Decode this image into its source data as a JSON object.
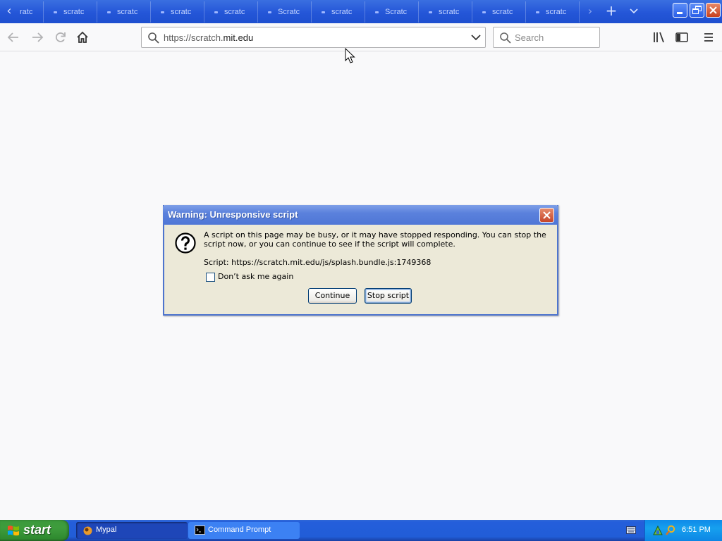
{
  "browser": {
    "tabs": [
      {
        "label": "ratc"
      },
      {
        "label": "scratc"
      },
      {
        "label": "scratc"
      },
      {
        "label": "scratc"
      },
      {
        "label": "scratc"
      },
      {
        "label": "Scratc"
      },
      {
        "label": "scratc"
      },
      {
        "label": "Scratc"
      },
      {
        "label": "scratc"
      },
      {
        "label": "scratc"
      },
      {
        "label": "scratc"
      }
    ],
    "url": {
      "prefix": "https://scratch.",
      "domain": "mit.edu"
    },
    "search_placeholder": "Search"
  },
  "dialog": {
    "title": "Warning: Unresponsive script",
    "message": "A script on this page may be busy, or it may have stopped responding. You can stop the script now, or you can continue to see if the script will complete.",
    "script_line": "Script: https://scratch.mit.edu/js/splash.bundle.js:1749368",
    "checkbox_label": "Don’t ask me again",
    "checkbox_checked": false,
    "continue_label": "Continue",
    "stop_label": "Stop script"
  },
  "taskbar": {
    "start_label": "start",
    "items": [
      {
        "label": "Mypal",
        "icon": "mypal-icon"
      },
      {
        "label": "Command Prompt",
        "icon": "command-prompt-icon"
      }
    ],
    "clock": "6:51 PM"
  },
  "colors": {
    "titlebar_blue": "#245edb",
    "dialog_face": "#ece9d8",
    "start_green": "#3e9c3c",
    "tray_blue": "#16a0ef"
  }
}
